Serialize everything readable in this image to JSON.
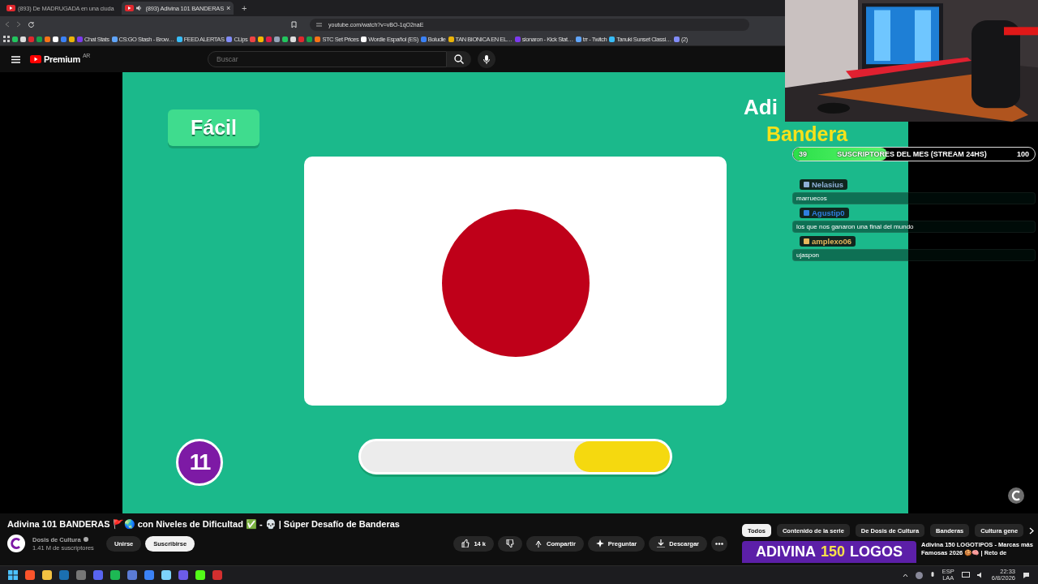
{
  "browser": {
    "tabs": [
      {
        "title": "(893) De MADRUGADA en una ciuda",
        "selected": false,
        "audio": false
      },
      {
        "title": "(893) Adivina 101 BANDERAS",
        "selected": true,
        "audio": true
      }
    ],
    "close": "×",
    "new_tab": "+",
    "url": "youtube.com/watch?v=vBO-1qO2naE",
    "bookmarks": [
      {
        "kind": "icon"
      },
      {
        "kind": "icon"
      },
      {
        "kind": "icon"
      },
      {
        "kind": "icon"
      },
      {
        "kind": "icon"
      },
      {
        "kind": "icon"
      },
      {
        "kind": "icon"
      },
      {
        "kind": "icon"
      },
      {
        "kind": "link",
        "label": "Chat Stats"
      },
      {
        "kind": "link",
        "label": "CS:GO Stash - Brow…"
      },
      {
        "kind": "link",
        "label": "FEED ALERTAS"
      },
      {
        "kind": "link",
        "label": "CLips"
      },
      {
        "kind": "icon"
      },
      {
        "kind": "icon"
      },
      {
        "kind": "icon"
      },
      {
        "kind": "icon"
      },
      {
        "kind": "icon"
      },
      {
        "kind": "icon"
      },
      {
        "kind": "icon"
      },
      {
        "kind": "icon"
      },
      {
        "kind": "link",
        "label": "STC Set Prices"
      },
      {
        "kind": "link",
        "label": "Wordle Español (ES)"
      },
      {
        "kind": "link",
        "label": "Boludle"
      },
      {
        "kind": "link",
        "label": "TAN BIONICA EN EL…"
      },
      {
        "kind": "link",
        "label": "sionaron - Kick Stat…"
      },
      {
        "kind": "link",
        "label": "trr - Twitch"
      },
      {
        "kind": "link",
        "label": "Tanuki Sunset Classi…"
      },
      {
        "kind": "link",
        "label": "(2)"
      }
    ]
  },
  "youtube": {
    "logo": "Premium",
    "region": "AR",
    "search": {
      "placeholder": "Buscar"
    }
  },
  "video": {
    "difficulty": "Fácil",
    "heading": [
      "Adi",
      "Bandera"
    ],
    "question_number": "11",
    "timer": {
      "level": 0.31
    }
  },
  "stream_overlay": {
    "goal": {
      "current": "39",
      "label": "SUSCRIPTORES DEL MES (STREAM 24HS)",
      "target": "100",
      "level": 0.39
    },
    "chat": [
      {
        "user": "Nelasius",
        "color": "#8fb0d8",
        "message": "marruecos"
      },
      {
        "user": "Agustip0",
        "color": "#2f7fe0",
        "message": "los que nos ganaron una final del mundo"
      },
      {
        "user": "amplexo06",
        "color": "#e6b85c",
        "message": "ujaspon"
      }
    ]
  },
  "info": {
    "title": "Adivina 101 BANDERAS 🚩🌏 con Niveles de Dificultad ✅ - 💀 | Súper Desafío de Banderas",
    "channel": "Dosis de Cultura",
    "subscribers": "1.41 M de suscriptores",
    "join": "Unirse",
    "subscribe": "Suscribirse",
    "likes": "14 k",
    "actions": [
      "Compartir",
      "Preguntar",
      "Descargar"
    ],
    "chips": [
      {
        "label": "Todos",
        "selected": true
      },
      {
        "label": "Contenido de la serie",
        "selected": false
      },
      {
        "label": "De Dosis de Cultura",
        "selected": false
      },
      {
        "label": "Banderas",
        "selected": false
      },
      {
        "label": "Cultura gene",
        "selected": false
      }
    ],
    "recommended": {
      "thumbnail": [
        {
          "text": "ADIVINA",
          "highlight": false
        },
        {
          "text": "150",
          "highlight": true
        },
        {
          "text": "LOGOS",
          "highlight": false
        }
      ],
      "title": "Adivina 150 LOGOTIPOS - Marcas más Famosas 2026 🍪🧠 | Reto de"
    }
  },
  "taskbar": {
    "language": "ESP",
    "layout": "LAA",
    "time": "22:33",
    "date": "6/8/2026"
  }
}
